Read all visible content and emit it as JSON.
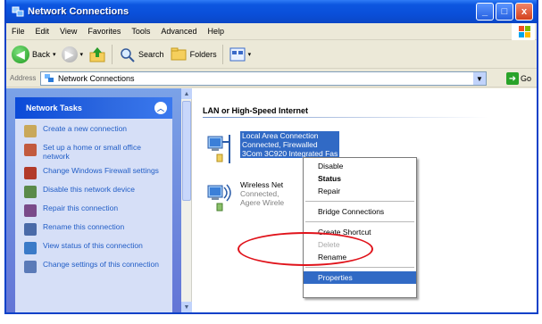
{
  "window": {
    "title": "Network Connections",
    "buttons": [
      "_",
      "□",
      "x"
    ]
  },
  "menubar": [
    "File",
    "Edit",
    "View",
    "Favorites",
    "Tools",
    "Advanced",
    "Help"
  ],
  "toolbar": {
    "back": "Back",
    "search": "Search",
    "folders": "Folders"
  },
  "address": {
    "label": "Address",
    "value": "Network Connections",
    "go": "Go"
  },
  "sidebar": {
    "title": "Network Tasks",
    "tasks": [
      {
        "label": "Create a new connection",
        "icon": "new-connection-icon",
        "color": "#c9a85a"
      },
      {
        "label": "Set up a home or small office network",
        "icon": "home-network-icon",
        "color": "#c25a3e"
      },
      {
        "label": "Change Windows Firewall settings",
        "icon": "firewall-icon",
        "color": "#b23a2a"
      },
      {
        "label": "Disable this network device",
        "icon": "disable-device-icon",
        "color": "#5a8a4a"
      },
      {
        "label": "Repair this connection",
        "icon": "repair-icon",
        "color": "#7a4a8a"
      },
      {
        "label": "Rename this connection",
        "icon": "rename-icon",
        "color": "#4a6aa8"
      },
      {
        "label": "View status of this connection",
        "icon": "status-icon",
        "color": "#3a7ac8"
      },
      {
        "label": "Change settings of this connection",
        "icon": "settings-icon",
        "color": "#5a7ab8"
      }
    ]
  },
  "main": {
    "group_header": "LAN or High-Speed Internet",
    "lan": {
      "name": "Local Area Connection",
      "status": "Connected, Firewalled",
      "device": "3Com 3C920 Integrated Fas"
    },
    "wireless": {
      "name": "Wireless Net",
      "status": "Connected,",
      "device": "Agere Wirele"
    }
  },
  "context_menu": {
    "items": [
      {
        "label": "Disable",
        "style": "normal"
      },
      {
        "label": "Status",
        "style": "bold"
      },
      {
        "label": "Repair",
        "style": "normal"
      },
      {
        "sep": true
      },
      {
        "label": "Bridge Connections",
        "style": "normal"
      },
      {
        "sep": true
      },
      {
        "label": "Create Shortcut",
        "style": "normal"
      },
      {
        "label": "Delete",
        "style": "disabled"
      },
      {
        "label": "Rename",
        "style": "normal"
      },
      {
        "sep": true
      },
      {
        "label": "Properties",
        "style": "selected"
      }
    ]
  },
  "colors": {
    "selection": "#316ac5",
    "annotation": "#e0131b",
    "titlebar": "#0a4fd9"
  }
}
